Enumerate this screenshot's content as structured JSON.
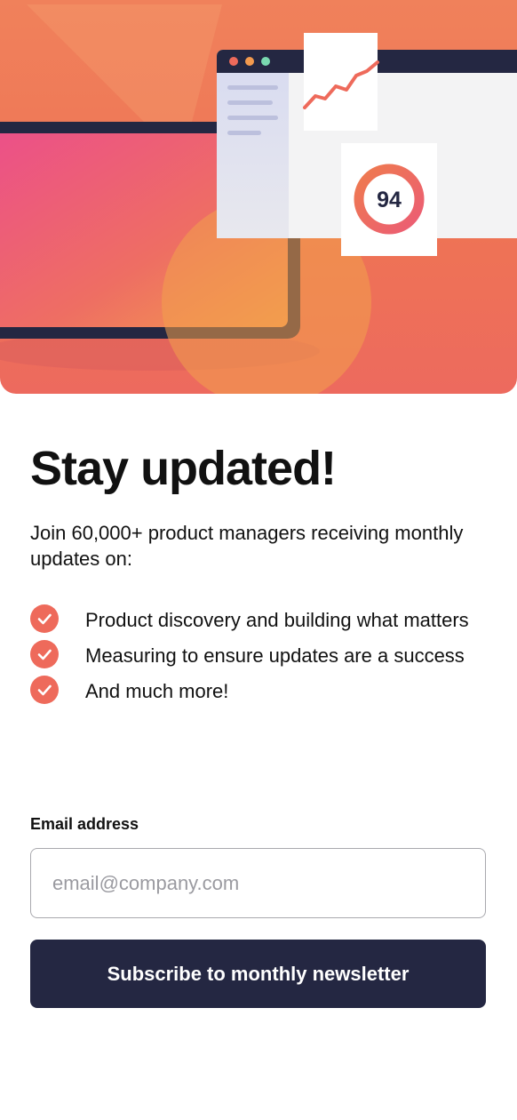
{
  "hero": {
    "score": "94"
  },
  "heading": "Stay updated!",
  "intro": "Join 60,000+ product managers receiving monthly updates on:",
  "features": [
    "Product discovery and building what matters",
    "Measuring to ensure updates are a success",
    "And much more!"
  ],
  "form": {
    "email_label": "Email address",
    "email_placeholder": "email@company.com",
    "email_value": "",
    "submit_label": "Subscribe to monthly newsletter"
  },
  "colors": {
    "accent": "#EE6A5B",
    "dark": "#242742"
  }
}
